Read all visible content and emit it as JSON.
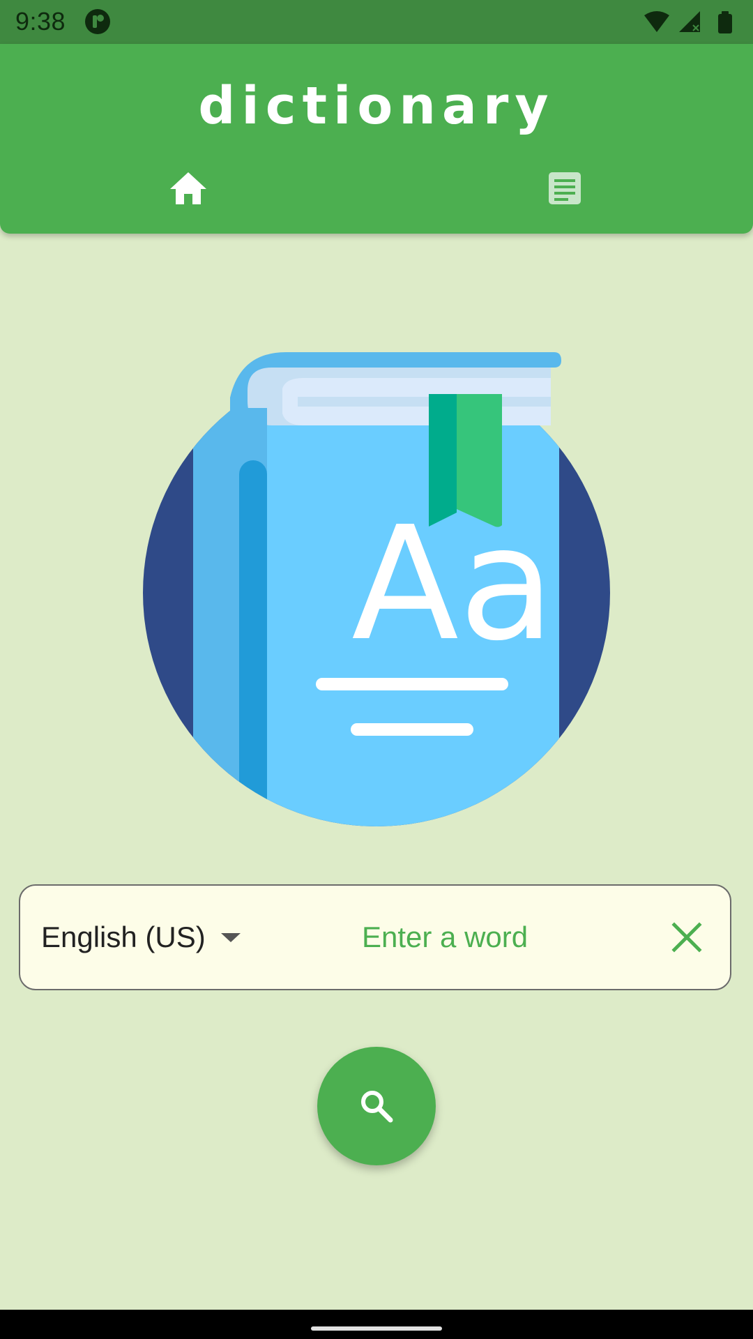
{
  "status_bar": {
    "time": "9:38",
    "icons": [
      "app-notification-icon",
      "wifi-icon",
      "signal-icon",
      "battery-icon"
    ]
  },
  "app_bar": {
    "title": "dictionary",
    "tabs": [
      {
        "icon": "home-icon",
        "selected": true
      },
      {
        "icon": "article-icon",
        "selected": false
      }
    ]
  },
  "illustration": {
    "icon": "dictionary-book-icon",
    "text": "Aa"
  },
  "search": {
    "language": "English (US)",
    "placeholder": "Enter a word",
    "value": ""
  },
  "colors": {
    "primary": "#4caf50",
    "status_bar": "#3f8940",
    "background": "#ddebc8",
    "field_background": "#fdfde8"
  }
}
